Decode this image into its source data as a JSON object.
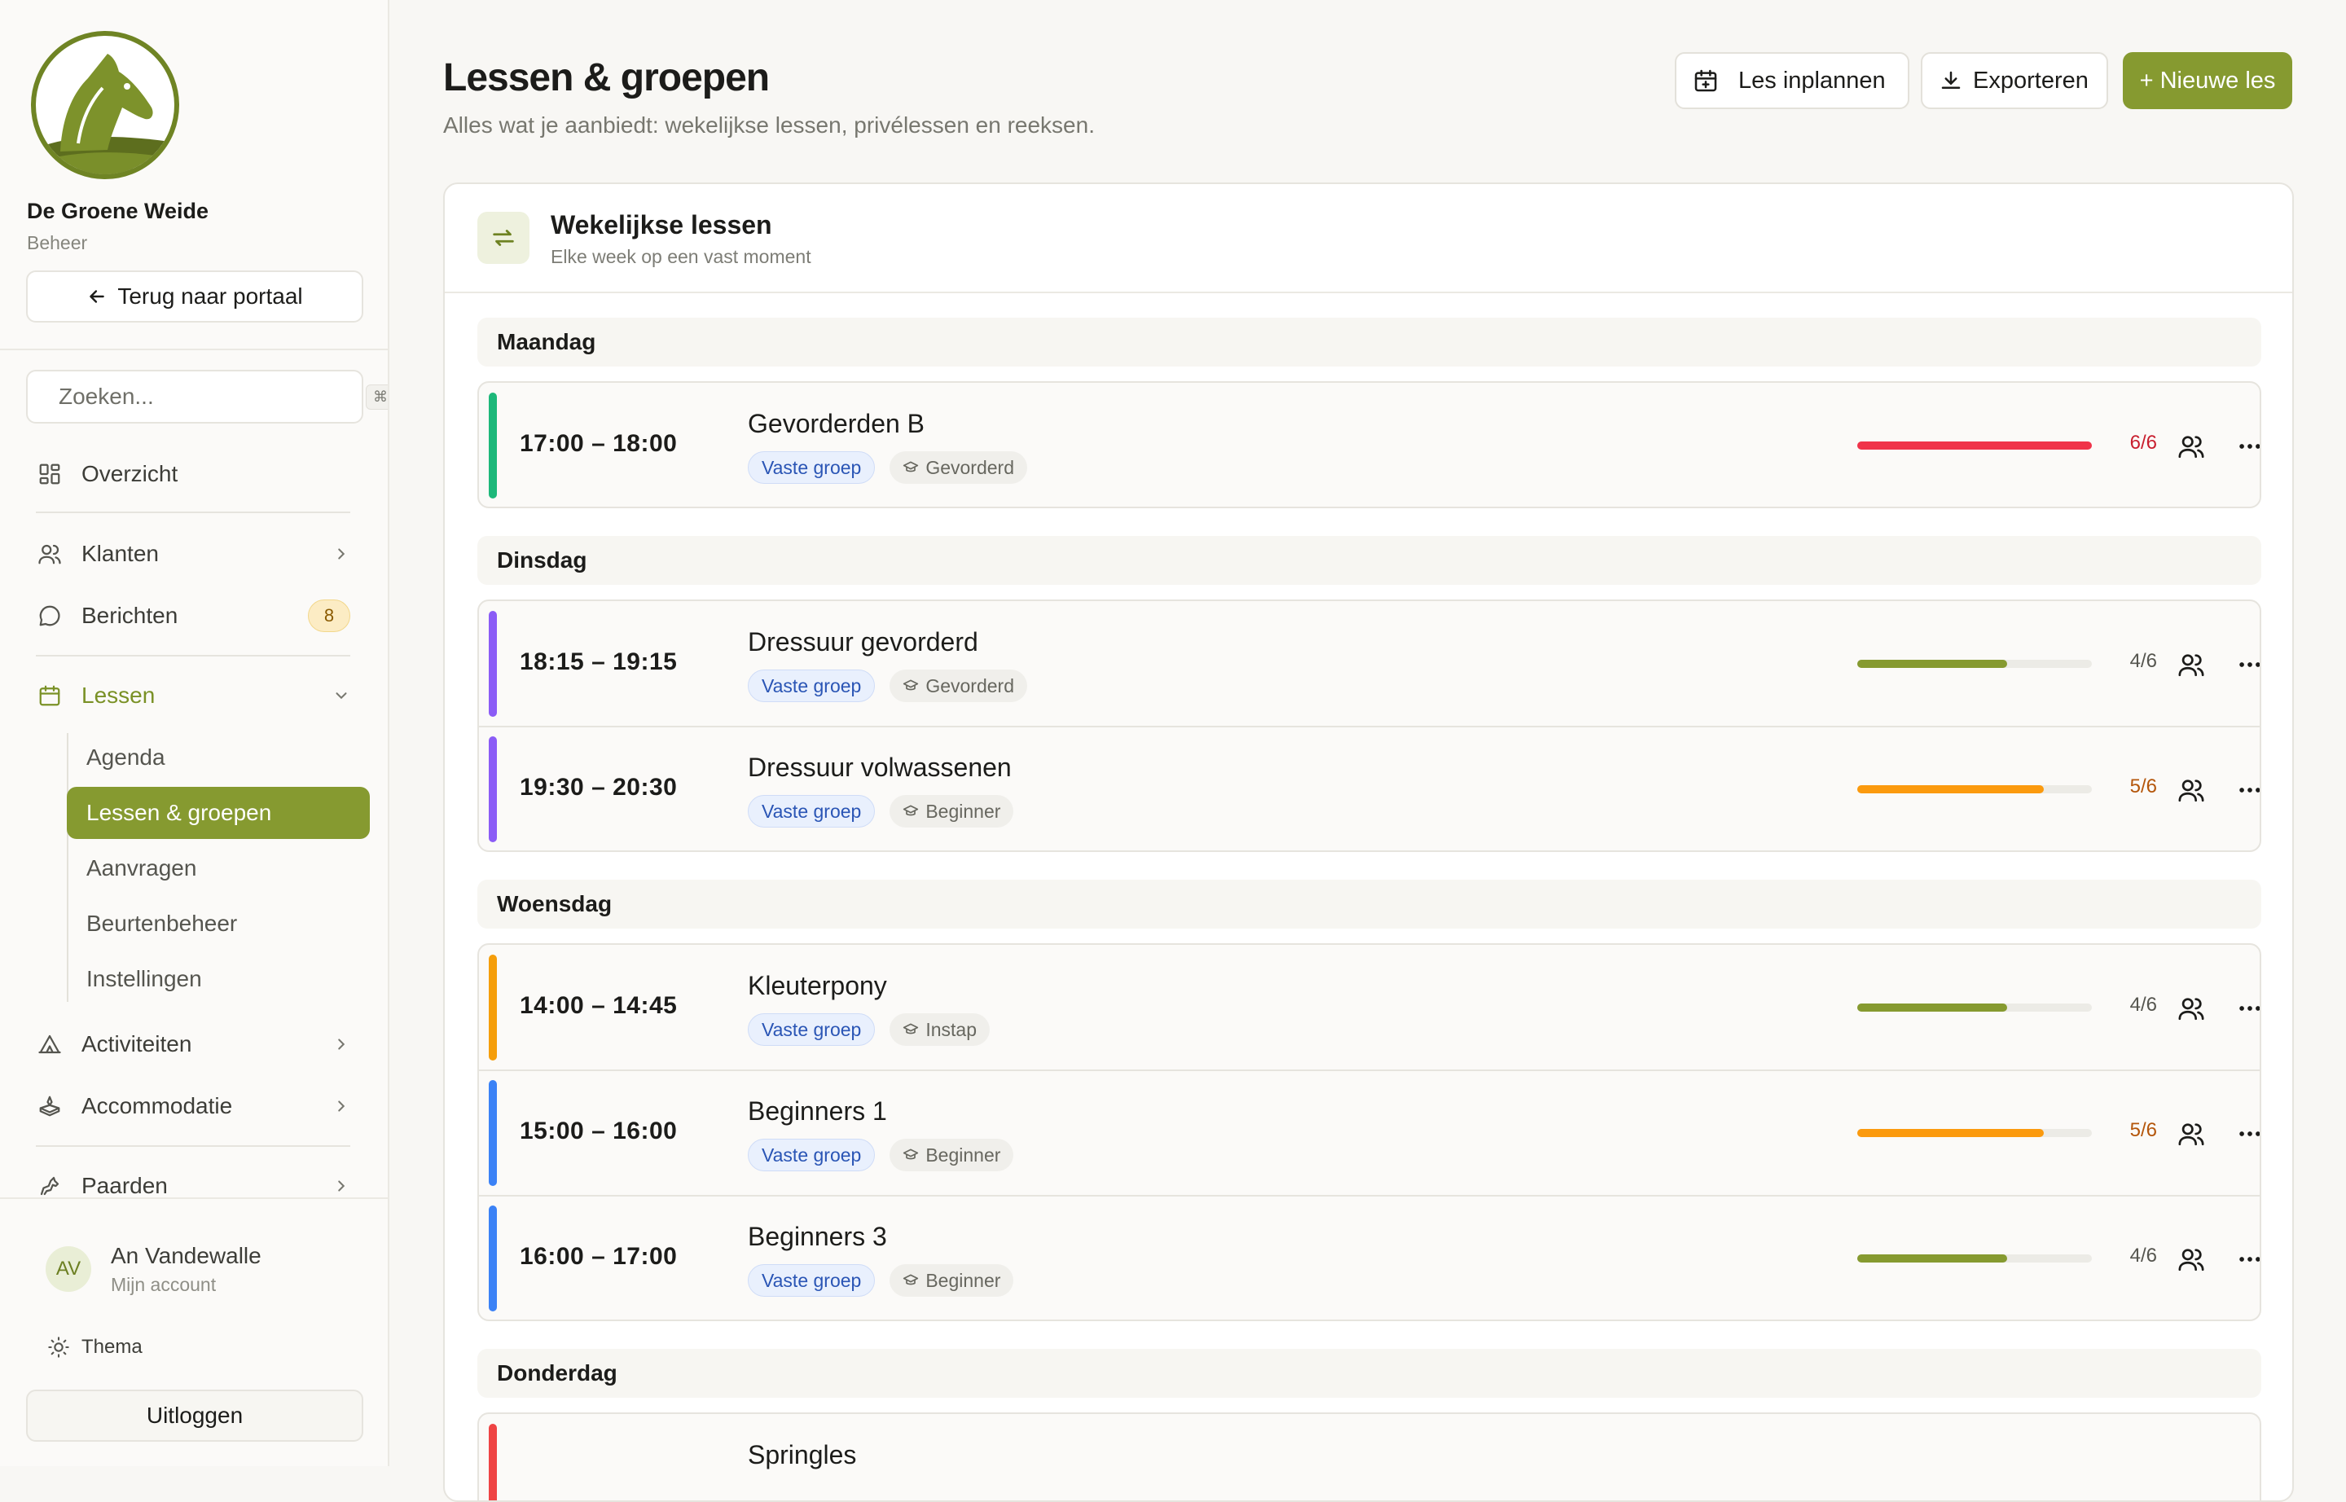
{
  "sidebar": {
    "org_name": "De Groene Weide",
    "org_role": "Beheer",
    "back_label": "Terug naar portaal",
    "search_placeholder": "Zoeken...",
    "search_shortcut": "⌘K",
    "nav": {
      "overzicht": "Overzicht",
      "klanten": "Klanten",
      "berichten": "Berichten",
      "berichten_badge": "8",
      "lessen": "Lessen",
      "activiteiten": "Activiteiten",
      "accommodatie": "Accommodatie",
      "paarden": "Paarden"
    },
    "lessen_sub": [
      "Agenda",
      "Lessen & groepen",
      "Aanvragen",
      "Beurtenbeheer",
      "Instellingen"
    ],
    "user": {
      "initials": "AV",
      "name": "An Vandewalle",
      "sub": "Mijn account"
    },
    "theme_label": "Thema",
    "logout_label": "Uitloggen"
  },
  "header": {
    "title": "Lessen & groepen",
    "subtitle": "Alles wat je aanbiedt: wekelijkse lessen, privélessen en reeksen.",
    "btn_schedule": "Les inplannen",
    "btn_export": "Exporteren",
    "btn_new": "+ Nieuwe les"
  },
  "card": {
    "title": "Wekelijkse lessen",
    "subtitle": "Elke week op een vast moment"
  },
  "colors": {
    "brand": "#869a30",
    "green": "#1db87a",
    "purple": "#8b5cf6",
    "orange": "#f59e0b",
    "blue": "#3b82f6",
    "red": "#ef4444"
  },
  "days": [
    {
      "day": "Maandag",
      "lessons": [
        {
          "time": "17:00 – 18:00",
          "name": "Gevorderden B",
          "tag": "Vaste groep",
          "level": "Gevorderd",
          "capacity": "6/6",
          "filled": 6,
          "max": 6,
          "accent": "#1db87a",
          "bar": "#f0334a",
          "label_color": "#c81e2e"
        }
      ]
    },
    {
      "day": "Dinsdag",
      "lessons": [
        {
          "time": "18:15 – 19:15",
          "name": "Dressuur gevorderd",
          "tag": "Vaste groep",
          "level": "Gevorderd",
          "capacity": "4/6",
          "filled": 4,
          "max": 6,
          "accent": "#8b5cf6",
          "bar": "#869a30",
          "label_color": "#55554f"
        },
        {
          "time": "19:30 – 20:30",
          "name": "Dressuur volwassenen",
          "tag": "Vaste groep",
          "level": "Beginner",
          "capacity": "5/6",
          "filled": 5,
          "max": 6,
          "accent": "#8b5cf6",
          "bar": "#fb9a0e",
          "label_color": "#b4560b"
        }
      ]
    },
    {
      "day": "Woensdag",
      "lessons": [
        {
          "time": "14:00 – 14:45",
          "name": "Kleuterpony",
          "tag": "Vaste groep",
          "level": "Instap",
          "capacity": "4/6",
          "filled": 4,
          "max": 6,
          "accent": "#f59e0b",
          "bar": "#869a30",
          "label_color": "#55554f"
        },
        {
          "time": "15:00 – 16:00",
          "name": "Beginners 1",
          "tag": "Vaste groep",
          "level": "Beginner",
          "capacity": "5/6",
          "filled": 5,
          "max": 6,
          "accent": "#3b82f6",
          "bar": "#fb9a0e",
          "label_color": "#b4560b"
        },
        {
          "time": "16:00 – 17:00",
          "name": "Beginners 3",
          "tag": "Vaste groep",
          "level": "Beginner",
          "capacity": "4/6",
          "filled": 4,
          "max": 6,
          "accent": "#3b82f6",
          "bar": "#869a30",
          "label_color": "#55554f"
        }
      ]
    },
    {
      "day": "Donderdag",
      "lessons": [
        {
          "time": "",
          "name": "Springles",
          "tag": "",
          "level": "",
          "capacity": "",
          "filled": 0,
          "max": 6,
          "accent": "#ef4444",
          "bar": "#869a30",
          "label_color": "#55554f"
        }
      ]
    }
  ]
}
